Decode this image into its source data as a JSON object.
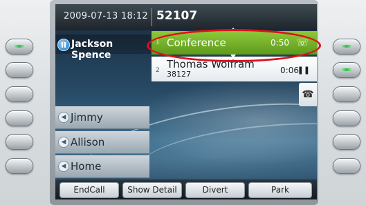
{
  "header": {
    "datetime": "2009-07-13 18:12",
    "extension": "52107"
  },
  "line": {
    "label": "Jackson Spence",
    "status_icon": "pause-line-icon"
  },
  "calls": [
    {
      "index": "1",
      "name": "Conference",
      "timer": "0:50",
      "state_icon": "active-call-icon",
      "selected": true
    },
    {
      "index": "2",
      "name": "Thomas Wolfram",
      "number": "38127",
      "timer": "0:06",
      "state_icon": "hold-icon",
      "hold_glyph": "❚❚"
    }
  ],
  "end_call_tab_glyph": "☎",
  "speed_dials": [
    {
      "label": "Jimmy",
      "icon": "speed-dial-icon"
    },
    {
      "label": "Allison",
      "icon": "speed-dial-icon"
    },
    {
      "label": "Home",
      "icon": "speed-dial-icon"
    }
  ],
  "softkeys": [
    "EndCall",
    "Show Detail",
    "Divert",
    "Park"
  ],
  "colors": {
    "accent": "#6aab24",
    "annotation": "#e0101a",
    "led_on": "#27c04a"
  }
}
